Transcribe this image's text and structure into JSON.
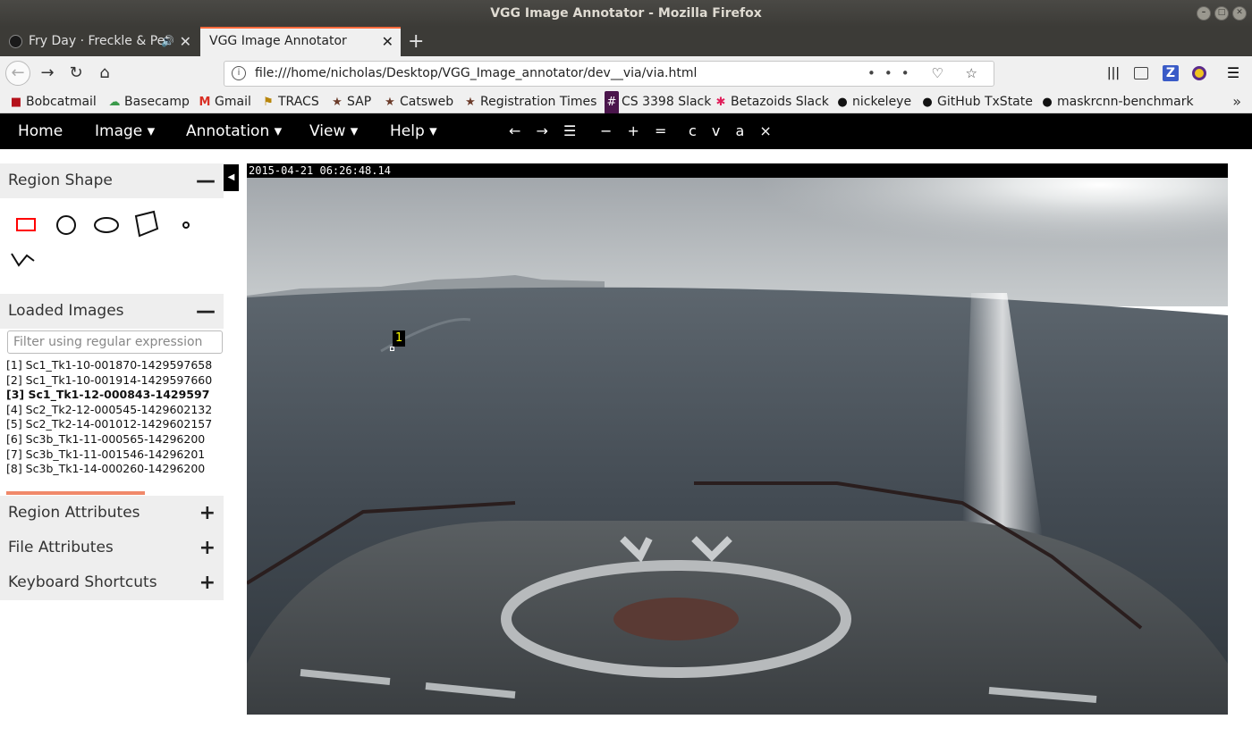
{
  "window": {
    "title": "VGG Image Annotator - Mozilla Firefox",
    "buttons": [
      "–",
      "□",
      "✕"
    ]
  },
  "tabs": [
    {
      "label": "Fry Day · Freckle & Pet",
      "icon": "spotify-icon",
      "active": false
    },
    {
      "label": "VGG Image Annotator",
      "active": true
    }
  ],
  "tab_close": "✕",
  "new_tab": "+",
  "nav": {
    "back": "←",
    "forward": "→",
    "reload": "↻",
    "home": "⌂",
    "url": "file:///home/nicholas/Desktop/VGG_Image_annotator/dev__via/via.html",
    "url_actions": "••• ♡ ☆",
    "info": "i"
  },
  "toolbar_icons": [
    "library-icon",
    "sidebar-icon",
    "zotero-icon",
    "extension-icon",
    "menu-icon"
  ],
  "bookmarks": [
    {
      "label": "Bobcatmail",
      "icon": "■"
    },
    {
      "label": "Basecamp",
      "icon": "☁"
    },
    {
      "label": "Gmail",
      "icon": "M"
    },
    {
      "label": "TRACS",
      "icon": "⚑"
    },
    {
      "label": "SAP",
      "icon": "★"
    },
    {
      "label": "Catsweb",
      "icon": "★"
    },
    {
      "label": "Registration Times",
      "icon": "★"
    },
    {
      "label": "CS 3398 Slack",
      "icon": "#"
    },
    {
      "label": "Betazoids Slack",
      "icon": "✱"
    },
    {
      "label": "nickeleye",
      "icon": "●"
    },
    {
      "label": "GitHub TxState",
      "icon": "●"
    },
    {
      "label": "maskrcnn-benchmark",
      "icon": "●"
    }
  ],
  "bookmarks_more": "»",
  "via_menu": {
    "home": "Home",
    "image": "Image ▾",
    "annotation": "Annotation ▾",
    "view": "View ▾",
    "help": "Help ▾",
    "tools_nav": "← → ☰",
    "tools_zoom": "− + =",
    "tools_edit": "c v a ×"
  },
  "panels": {
    "region_shape": {
      "title": "Region Shape",
      "toggle": "—"
    },
    "loaded_images": {
      "title": "Loaded Images",
      "toggle": "—",
      "filter_placeholder": "Filter using regular expression",
      "items": [
        "[1] Sc1_Tk1-10-001870-1429597658",
        "[2] Sc1_Tk1-10-001914-1429597660",
        "[3] Sc1_Tk1-12-000843-1429597",
        "[4] Sc2_Tk2-12-000545-1429602132",
        "[5] Sc2_Tk2-14-001012-1429602157",
        "[6] Sc3b_Tk1-11-000565-14296200",
        "[7] Sc3b_Tk1-11-001546-14296201",
        "[8] Sc3b_Tk1-14-000260-14296200"
      ],
      "current_index": 2,
      "scroll_fraction": 0.67
    },
    "region_attributes": {
      "title": "Region Attributes",
      "toggle": "+"
    },
    "file_attributes": {
      "title": "File Attributes",
      "toggle": "+"
    },
    "keyboard_shortcuts": {
      "title": "Keyboard Shortcuts",
      "toggle": "+"
    }
  },
  "panel_toggle": "◀",
  "canvas": {
    "timestamp": "2015-04-21 06:26:48.14",
    "region_label": "1",
    "accent_shape_color": "#ff0000"
  }
}
